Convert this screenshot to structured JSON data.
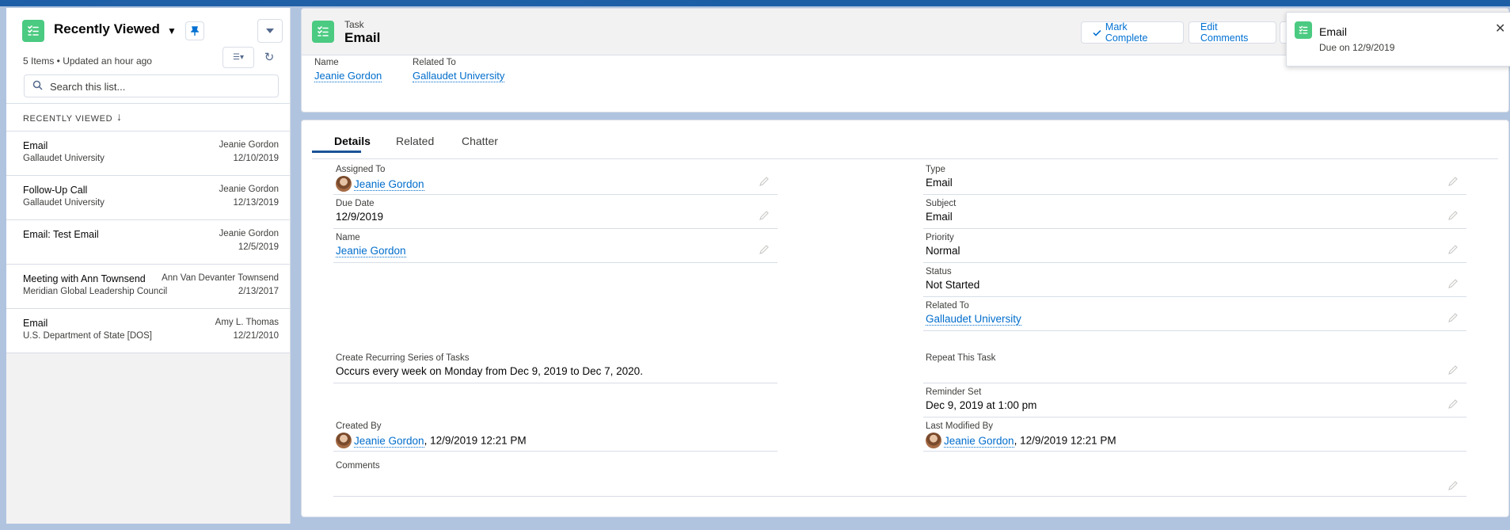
{
  "colors": {
    "accent": "#0070d2",
    "task_icon": "#4bca81",
    "link": "#006dcc"
  },
  "list_view": {
    "icon": "task-icon",
    "title": "Recently Viewed",
    "meta": "5 Items • Updated an hour ago",
    "search_placeholder": "Search this list...",
    "sort_label": "RECENTLY VIEWED",
    "rows": [
      {
        "title": "Email",
        "subtitle": "Gallaudet University",
        "name": "Jeanie Gordon",
        "date": "12/10/2019"
      },
      {
        "title": "Follow-Up Call",
        "subtitle": "Gallaudet University",
        "name": "Jeanie Gordon",
        "date": "12/13/2019"
      },
      {
        "title": "Email: Test Email",
        "subtitle": "",
        "name": "Jeanie Gordon",
        "date": "12/5/2019"
      },
      {
        "title": "Meeting with Ann Townsend",
        "subtitle": "Meridian Global Leadership Council",
        "name": "Ann Van Devanter Townsend",
        "date": "2/13/2017"
      },
      {
        "title": "Email",
        "subtitle": "U.S. Department of State [DOS]",
        "name": "Amy L. Thomas",
        "date": "12/21/2010"
      }
    ]
  },
  "record": {
    "object_type": "Task",
    "name": "Email",
    "buttons": {
      "mark_complete": "Mark Complete",
      "edit_comments": "Edit Comments"
    },
    "highlights": {
      "name_label": "Name",
      "name_value": "Jeanie Gordon",
      "related_label": "Related To",
      "related_value": "Gallaudet University"
    },
    "tabs": {
      "details": "Details",
      "related": "Related",
      "chatter": "Chatter"
    },
    "fields": {
      "assigned_to": {
        "label": "Assigned To",
        "value": "Jeanie Gordon"
      },
      "due_date": {
        "label": "Due Date",
        "value": "12/9/2019"
      },
      "name": {
        "label": "Name",
        "value": "Jeanie Gordon"
      },
      "recurring": {
        "label": "Create Recurring Series of Tasks",
        "value": "Occurs every week on Monday from Dec 9, 2019 to Dec 7, 2020."
      },
      "created_by": {
        "label": "Created By",
        "user": "Jeanie Gordon",
        "stamp": ", 12/9/2019 12:21 PM"
      },
      "comments": {
        "label": "Comments",
        "value": ""
      },
      "type": {
        "label": "Type",
        "value": "Email"
      },
      "subject": {
        "label": "Subject",
        "value": "Email"
      },
      "priority": {
        "label": "Priority",
        "value": "Normal"
      },
      "status": {
        "label": "Status",
        "value": "Not Started"
      },
      "related_to": {
        "label": "Related To",
        "value": "Gallaudet University"
      },
      "repeat": {
        "label": "Repeat This Task",
        "value": ""
      },
      "reminder": {
        "label": "Reminder Set",
        "value": "Dec 9, 2019 at 1:00 pm"
      },
      "last_modified": {
        "label": "Last Modified By",
        "user": "Jeanie Gordon",
        "stamp": ", 12/9/2019 12:21 PM"
      }
    }
  },
  "toast": {
    "title": "Email",
    "subtitle": "Due on 12/9/2019"
  }
}
